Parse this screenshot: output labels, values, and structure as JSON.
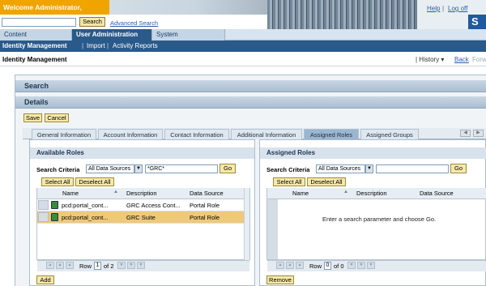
{
  "header": {
    "welcome": "Welcome Administrator,",
    "search_button": "Search",
    "advanced_search": "Advanced Search",
    "help": "Help",
    "separator": "|",
    "logoff": "Log off",
    "logo": "S"
  },
  "topnav": {
    "items": [
      "Content Administration",
      "User Administration",
      "System Administration"
    ],
    "active_index": 1
  },
  "subnav": {
    "items": [
      "Identity Management",
      "Import",
      "Activity Reports"
    ],
    "separator": "|"
  },
  "page": {
    "title": "Identity Management",
    "history": "| History ▾",
    "back": "Back",
    "forward": "Forw"
  },
  "sections": {
    "search": "Search",
    "details": "Details"
  },
  "toolbar": {
    "save": "Save",
    "cancel": "Cancel"
  },
  "tabs": {
    "items": [
      "General Information",
      "Account Information",
      "Contact Information",
      "Additional Information",
      "Assigned Roles",
      "Assigned Groups"
    ],
    "active_index": 4
  },
  "available": {
    "title": "Available Roles",
    "criteria_label": "Search Criteria",
    "source": "All Data Sources",
    "query": "*GRC*",
    "go": "Go",
    "select_all": "Select All",
    "deselect_all": "Deselect All",
    "columns": [
      "Name",
      "Description",
      "Data Source"
    ],
    "rows": [
      {
        "name": "pcd:portal_cont...",
        "description": "GRC Access Cont...",
        "source": "Portal Role",
        "selected": false
      },
      {
        "name": "pcd:portal_cont...",
        "description": "GRC Suite",
        "source": "Portal Role",
        "selected": true
      }
    ],
    "pager_label": "Row",
    "pager_current": "1",
    "pager_total": "of 2",
    "add": "Add"
  },
  "assigned": {
    "title": "Assigned Roles",
    "criteria_label": "Search Criteria",
    "source": "All Data Sources",
    "query": "",
    "go": "Go",
    "select_all": "Select All",
    "deselect_all": "Deselect All",
    "columns": [
      "Name",
      "Description",
      "Data Source"
    ],
    "empty_message": "Enter a search parameter and choose Go.",
    "pager_label": "Row",
    "pager_current": "0",
    "pager_total": "of 0",
    "remove": "Remove"
  },
  "colors": {
    "welcome_bg": "#f0a400",
    "nav_active": "#2a5a8a",
    "selected_row": "#efc87a",
    "button_bg": "#f6e9a9"
  }
}
